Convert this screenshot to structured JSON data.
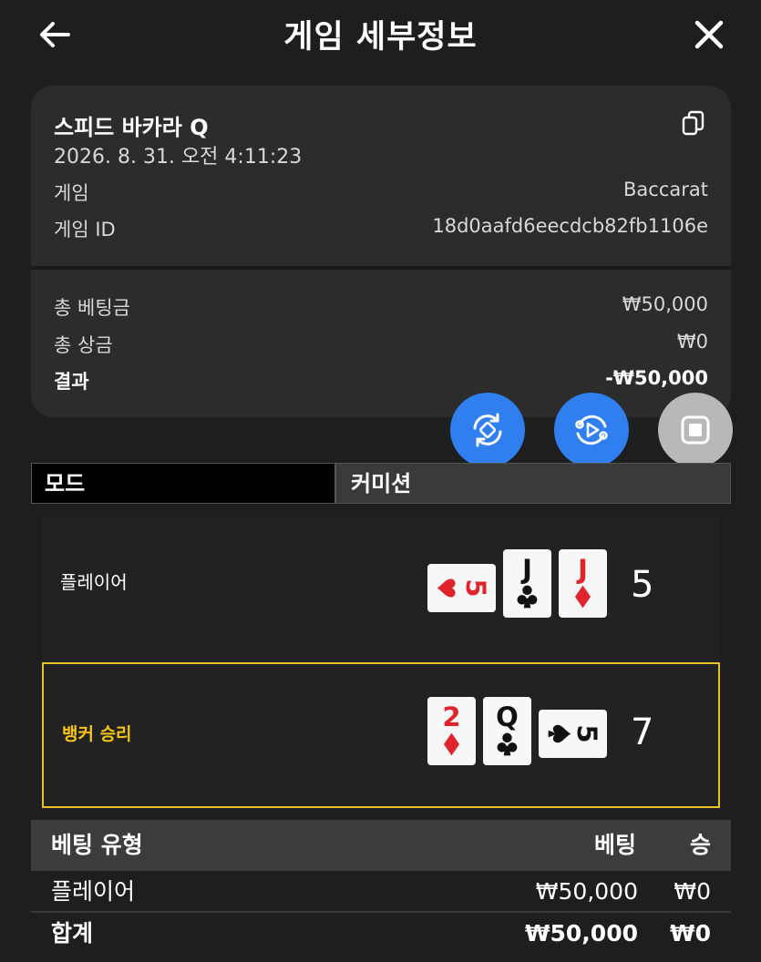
{
  "header": {
    "title": "게임 세부정보"
  },
  "summary": {
    "game_name": "스피드 바카라 Q",
    "timestamp": "2026. 8. 31. 오전 4:11:23",
    "game_label": "게임",
    "game_value": "Baccarat",
    "game_id_label": "게임 ID",
    "game_id_value": "18d0aafd6eecdcb82fb1106e",
    "total_bet_label": "총 베팅금",
    "total_bet_value": "₩50,000",
    "total_win_label": "총 상금",
    "total_win_value": "₩0",
    "result_label": "결과",
    "result_value": "-₩50,000"
  },
  "actions": [
    {
      "icon": "replay-rotate-icon"
    },
    {
      "icon": "video-replay-icon"
    },
    {
      "icon": "stop-icon"
    }
  ],
  "tabs": {
    "mode": "모드",
    "commission": "커미션"
  },
  "hands": {
    "player": {
      "label": "플레이어",
      "total": "5",
      "cards": [
        {
          "rank": "5",
          "suit": "heart",
          "color": "#e0242b",
          "rotated": true
        },
        {
          "rank": "J",
          "suit": "club",
          "color": "#111111",
          "rotated": false
        },
        {
          "rank": "J",
          "suit": "diamond",
          "color": "#e0242b",
          "rotated": false
        }
      ]
    },
    "banker": {
      "label": "뱅커 승리",
      "total": "7",
      "cards": [
        {
          "rank": "2",
          "suit": "diamond",
          "color": "#e0242b",
          "rotated": false
        },
        {
          "rank": "Q",
          "suit": "club",
          "color": "#111111",
          "rotated": false
        },
        {
          "rank": "5",
          "suit": "spade",
          "color": "#111111",
          "rotated": true
        }
      ]
    }
  },
  "colors": {
    "accent_blue": "#2f7ff0",
    "winner_gold": "#f5c518",
    "card_red": "#e0242b"
  },
  "bets": {
    "headers": {
      "type": "베팅 유형",
      "bet": "베팅",
      "win": "승"
    },
    "rows": [
      {
        "type": "플레이어",
        "bet": "₩50,000",
        "win": "₩0"
      }
    ],
    "total": {
      "type": "합계",
      "bet": "₩50,000",
      "win": "₩0"
    }
  }
}
